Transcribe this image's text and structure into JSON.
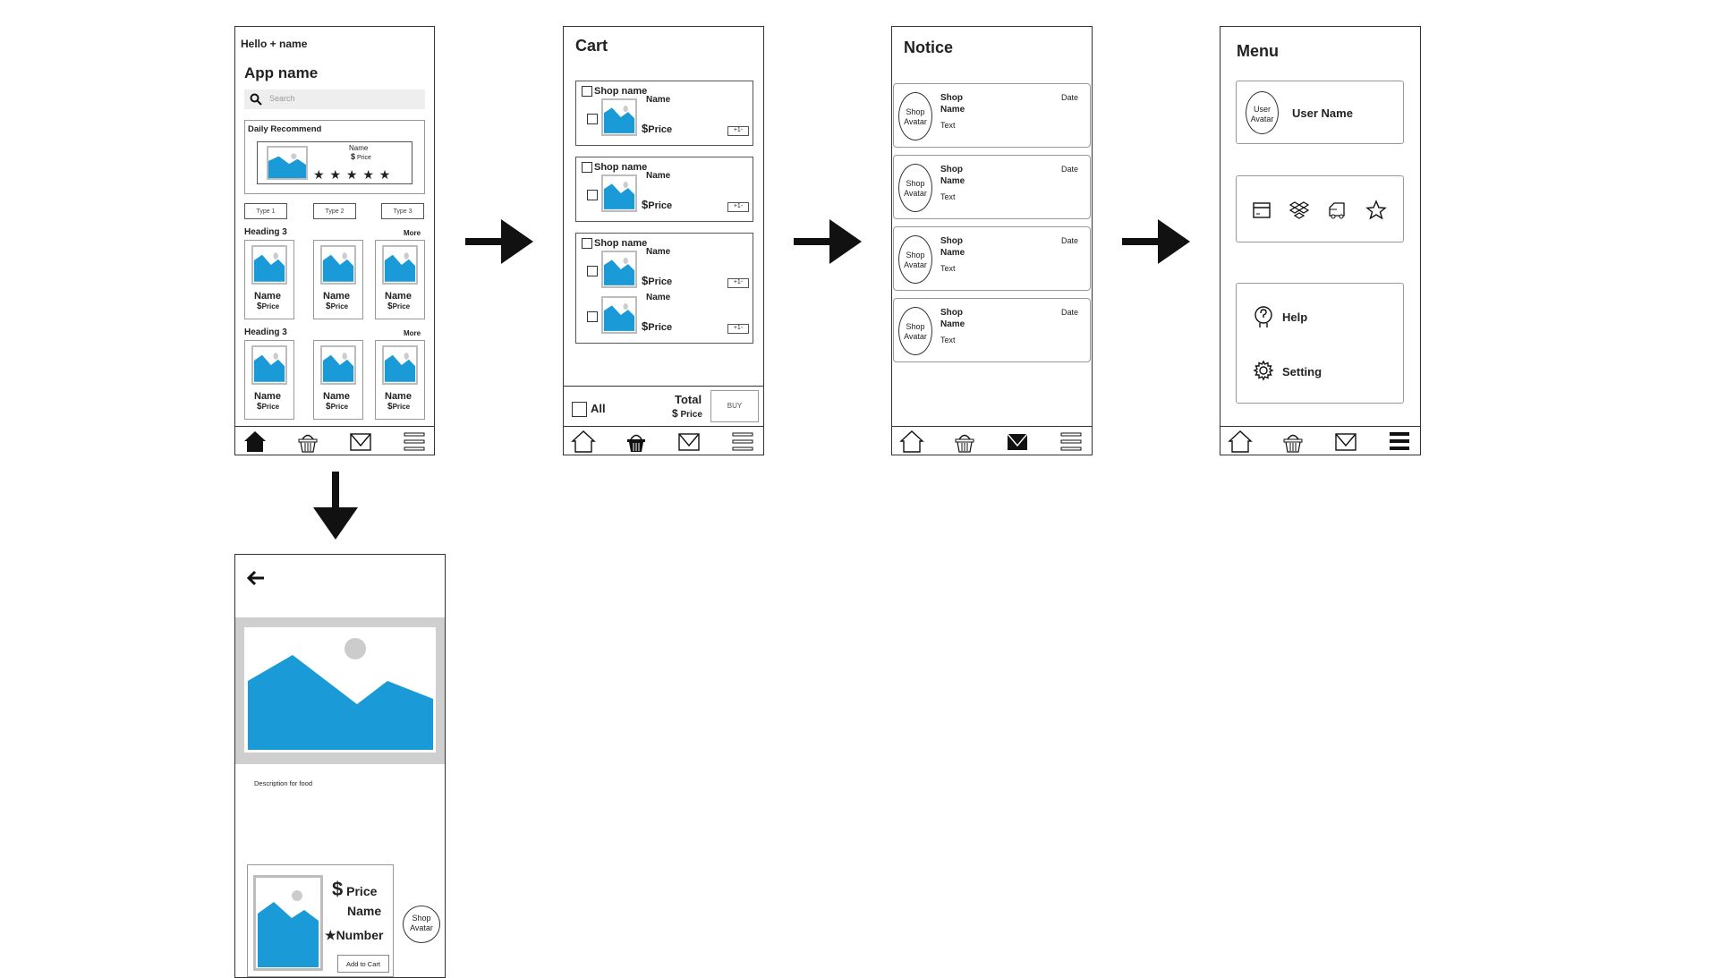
{
  "colors": {
    "accent": "#1a9bd7",
    "frame": "#bdbdbd",
    "ink": "#111111"
  },
  "home": {
    "greeting": "Hello + name",
    "app_name": "App name",
    "search_placeholder": "Search",
    "daily": {
      "title": "Daily Recommend",
      "name": "Name",
      "price": "Price",
      "stars": "★ ★ ★ ★ ★"
    },
    "types": [
      "Type 1",
      "Type 2",
      "Type 3"
    ],
    "sections": [
      {
        "heading": "Heading 3",
        "more": "More",
        "items": [
          {
            "name": "Name",
            "price": "Price"
          },
          {
            "name": "Name",
            "price": "Price"
          },
          {
            "name": "Name",
            "price": "Price"
          }
        ]
      },
      {
        "heading": "Heading 3",
        "more": "More",
        "items": [
          {
            "name": "Name",
            "price": "Price"
          },
          {
            "name": "Name",
            "price": "Price"
          },
          {
            "name": "Name",
            "price": "Price"
          }
        ]
      }
    ]
  },
  "cart": {
    "title": "Cart",
    "shops": [
      {
        "shop": "Shop name",
        "items": [
          {
            "name": "Name",
            "price": "Price",
            "qty": "+1-"
          }
        ]
      },
      {
        "shop": "Shop name",
        "items": [
          {
            "name": "Name",
            "price": "Price",
            "qty": "+1-"
          }
        ]
      },
      {
        "shop": "Shop name",
        "items": [
          {
            "name": "Name",
            "price": "Price",
            "qty": "+1-"
          },
          {
            "name": "Name",
            "price": "Price",
            "qty": "+1-"
          }
        ]
      }
    ],
    "all": "All",
    "total": "Total",
    "total_price": "Price",
    "buy": "BUY"
  },
  "notice": {
    "title": "Notice",
    "items": [
      {
        "avatar": "Shop Avatar",
        "shop": "Shop",
        "name": "Name",
        "text": "Text",
        "date": "Date"
      },
      {
        "avatar": "Shop Avatar",
        "shop": "Shop",
        "name": "Name",
        "text": "Text",
        "date": "Date"
      },
      {
        "avatar": "Shop Avatar",
        "shop": "Shop",
        "name": "Name",
        "text": "Text",
        "date": "Date"
      },
      {
        "avatar": "Shop Avatar",
        "shop": "Shop",
        "name": "Name",
        "text": "Text",
        "date": "Date"
      }
    ]
  },
  "menu": {
    "title": "Menu",
    "user_avatar": "User Avatar",
    "user_name": "User Name",
    "help": "Help",
    "setting": "Setting"
  },
  "detail": {
    "description": "Description for food",
    "price": "Price",
    "name": "Name",
    "number": "Number",
    "add_to_cart": "Add to Cart",
    "shop_avatar": "Shop Avatar"
  },
  "currency": "$"
}
